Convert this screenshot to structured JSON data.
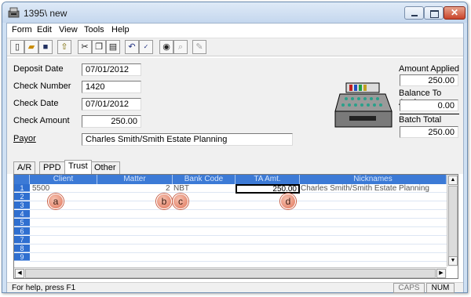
{
  "window": {
    "title": "1395\\ new"
  },
  "menu": {
    "items": [
      "Form",
      "Edit",
      "View",
      "Tools",
      "Help"
    ]
  },
  "toolbar": {
    "icons": [
      "new-document-icon",
      "open-folder-icon",
      "save-icon",
      "export-icon",
      "cut-icon",
      "copy-icon",
      "paste-icon",
      "undo-icon",
      "spell-check-icon",
      "find-icon",
      "find-next-icon",
      "sign-icon"
    ]
  },
  "form": {
    "deposit_date": {
      "label": "Deposit Date",
      "value": "07/01/2012"
    },
    "check_number": {
      "label": "Check Number",
      "value": "1420"
    },
    "check_date": {
      "label": "Check Date",
      "value": "07/01/2012"
    },
    "check_amount": {
      "label": "Check Amount",
      "value": "250.00"
    },
    "payor": {
      "label": "Payor",
      "value": "Charles Smith/Smith Estate Planning"
    }
  },
  "summary": {
    "amount_applied": {
      "label": "Amount Applied",
      "value": "250.00"
    },
    "balance_to_apply": {
      "label": "Balance To Apply",
      "value": "0.00"
    },
    "batch_total": {
      "label": "Batch Total",
      "value": "250.00"
    }
  },
  "tabs": [
    "A/R",
    "PPD",
    "Trust",
    "Other"
  ],
  "active_tab": "Trust",
  "grid": {
    "columns": [
      "Client",
      "Matter",
      "Bank Code",
      "TA Amt.",
      "Nicknames"
    ],
    "row_numbers": [
      "1",
      "2",
      "3",
      "4",
      "5",
      "6",
      "7",
      "8",
      "9"
    ],
    "rows": [
      {
        "client": "5500",
        "matter": "2",
        "bank_code": "NBT",
        "ta_amt": "250.00",
        "nicknames": "Charles Smith/Smith Estate Planning"
      }
    ]
  },
  "callouts": [
    "a",
    "b",
    "c",
    "d"
  ],
  "status": {
    "help": "For help, press F1",
    "caps": "CAPS",
    "num": "NUM"
  },
  "colors": {
    "grid_header": "#3c7ad6",
    "row_number": "#2f6fd0",
    "callout": "#e0755a",
    "close_button": "#c9432a"
  }
}
